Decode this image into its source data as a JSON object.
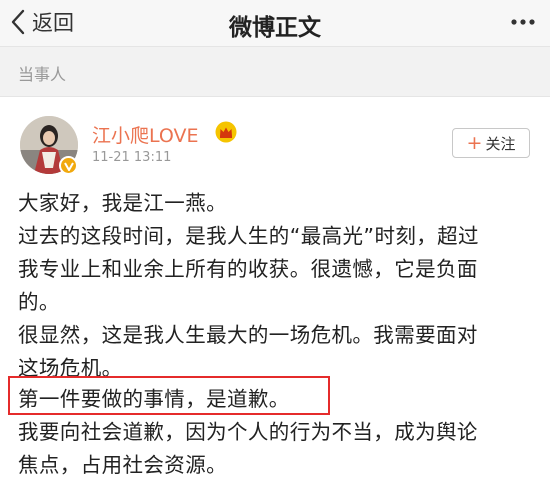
{
  "nav": {
    "back_label": "返回",
    "title": "微博正文"
  },
  "section": {
    "label": "当事人"
  },
  "post": {
    "username": "江小爬LOVE",
    "timestamp": "11-21 13:11",
    "follow_label": "关注",
    "lines": [
      "大家好，我是江一燕。",
      "过去的这段时间，是我人生的“最高光”时刻，超过",
      "我专业上和业余上所有的收获。很遗憾，它是负面",
      "的。",
      "很显然，这是我人生最大的一场危机。我需要面对",
      "这场危机。",
      "第一件要做的事情，是道歉。",
      "我要向社会道歉，因为个人的行为不当，成为舆论",
      "焦点，占用社会资源。"
    ]
  },
  "colors": {
    "username": "#eb7350",
    "highlight_box": "#e52b2b",
    "verified_badge": "#f1a90e"
  },
  "icons": [
    "back-chevron-icon",
    "more-icon",
    "verified-icon",
    "crown-icon",
    "plus-icon"
  ]
}
